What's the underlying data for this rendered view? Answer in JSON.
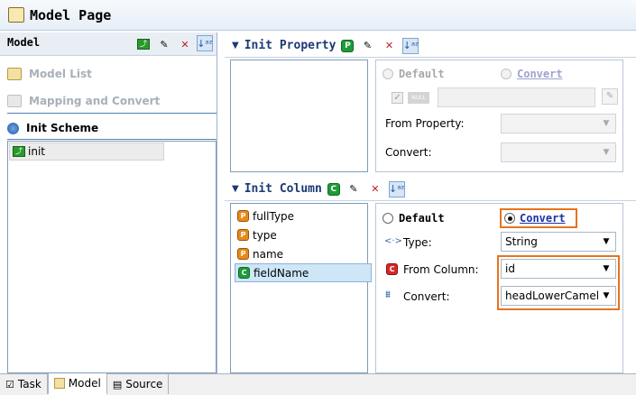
{
  "window": {
    "title": "Model Page"
  },
  "left": {
    "title": "Model",
    "nav": [
      {
        "label": "Model List"
      },
      {
        "label": "Mapping and Convert"
      },
      {
        "label": "Init Scheme"
      }
    ],
    "schemes": [
      {
        "label": "init"
      }
    ]
  },
  "init_property": {
    "title": "Init Property",
    "default_label": "Default",
    "convert_label": "Convert",
    "null_tag": "NULL",
    "from_property_label": "From Property:",
    "convert_field_label": "Convert:"
  },
  "init_column": {
    "title": "Init Column",
    "items": [
      {
        "label": "fullType",
        "kind": "O"
      },
      {
        "label": "type",
        "kind": "O"
      },
      {
        "label": "name",
        "kind": "O"
      },
      {
        "label": "fieldName",
        "kind": "C"
      }
    ],
    "default_label": "Default",
    "convert_label": "Convert",
    "selected_mode": "Convert",
    "type_label": "Type:",
    "type_value": "String",
    "from_column_label": "From Column:",
    "from_column_value": "id",
    "convert_field_label": "Convert:",
    "convert_value": "headLowerCamel"
  },
  "bottom_tabs": [
    {
      "label": "Task"
    },
    {
      "label": "Model"
    },
    {
      "label": "Source"
    }
  ],
  "colors": {
    "highlight": "#e8731d",
    "section_title": "#1b3a73",
    "link": "#1a31a8"
  }
}
